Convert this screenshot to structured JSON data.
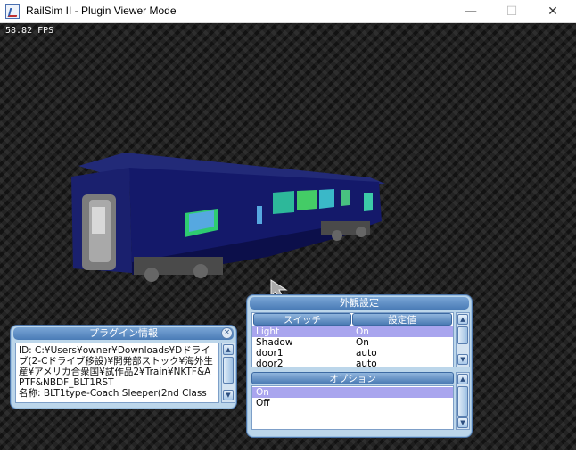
{
  "window": {
    "title": "RailSim II - Plugin Viewer Mode",
    "minimize": "—",
    "maximize": "☐",
    "close": "✕"
  },
  "viewport": {
    "fps": "58.82 FPS"
  },
  "info_panel": {
    "title": "プラグイン情報",
    "close_glyph": "×",
    "text": "ID: C:¥Users¥owner¥Downloads¥Dドライブ(2-Cドライブ移設)¥開発部ストック¥海外生産¥アメリカ合衆国¥試作品2¥Train¥NKTF&APTF&NBDF_BLT1RST\n名称: BLT1type-Coach Sleeper(2nd Class"
  },
  "settings_panel": {
    "title": "外観設定",
    "col_switch": "スイッチ",
    "col_value": "設定値",
    "rows": [
      {
        "name": "Light",
        "value": "On"
      },
      {
        "name": "Shadow",
        "value": "On"
      },
      {
        "name": "door1",
        "value": "auto"
      },
      {
        "name": "door2",
        "value": "auto"
      }
    ],
    "options_title": "オプション",
    "options": [
      "On",
      "Off"
    ]
  },
  "colors": {
    "train_body": "#1a1f6e",
    "panel_bg": "#bcd6ea",
    "selection": "#a9a5ee"
  }
}
